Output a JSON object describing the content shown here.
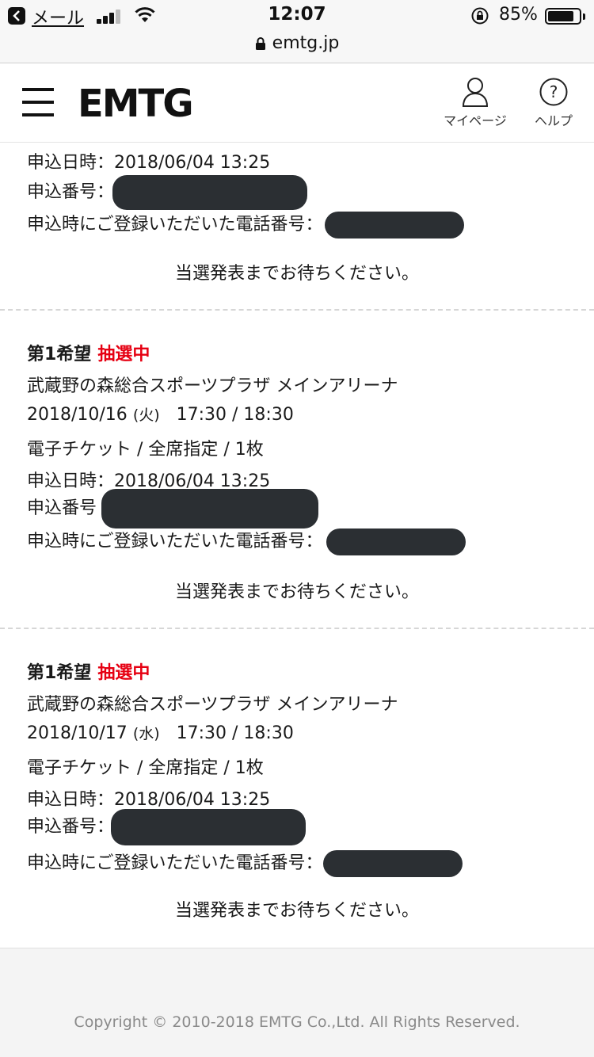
{
  "status_bar": {
    "back_label": "メール",
    "time": "12:07",
    "battery_percent": "85%",
    "battery_level": 0.85
  },
  "url_bar": {
    "domain": "emtg.jp"
  },
  "header": {
    "logo": "EMTG",
    "mypage_label": "マイページ",
    "help_label": "ヘルプ"
  },
  "entries": [
    {
      "applied_at_label": "申込日時：",
      "applied_at": "2018/06/04 13:25",
      "number_label": "申込番号：",
      "phone_label": "申込時にご登録いただいた電話番号：",
      "wait_message": "当選発表までお待ちください。"
    },
    {
      "hope": "第1希望",
      "status": "抽選中",
      "venue": "武蔵野の森総合スポーツプラザ メインアリーナ",
      "date": "2018/10/16",
      "weekday": "(火)",
      "times": "17:30 / 18:30",
      "ticket": "電子チケット / 全席指定 / 1枚",
      "applied_at_label": "申込日時：",
      "applied_at": "2018/06/04 13:25",
      "number_label": "申込番号",
      "phone_label": "申込時にご登録いただいた電話番号：",
      "wait_message": "当選発表までお待ちください。"
    },
    {
      "hope": "第1希望",
      "status": "抽選中",
      "venue": "武蔵野の森総合スポーツプラザ メインアリーナ",
      "date": "2018/10/17",
      "weekday": "(水)",
      "times": "17:30 / 18:30",
      "ticket": "電子チケット / 全席指定 / 1枚",
      "applied_at_label": "申込日時：",
      "applied_at": "2018/06/04 13:25",
      "number_label": "申込番号：",
      "phone_label": "申込時にご登録いただいた電話番号：",
      "wait_message": "当選発表までお待ちください。"
    }
  ],
  "footer": {
    "copyright": "Copyright © 2010-2018 EMTG Co.,Ltd. All Rights Reserved."
  },
  "colors": {
    "accent_red": "#e60012",
    "redaction": "#2b2f33"
  }
}
